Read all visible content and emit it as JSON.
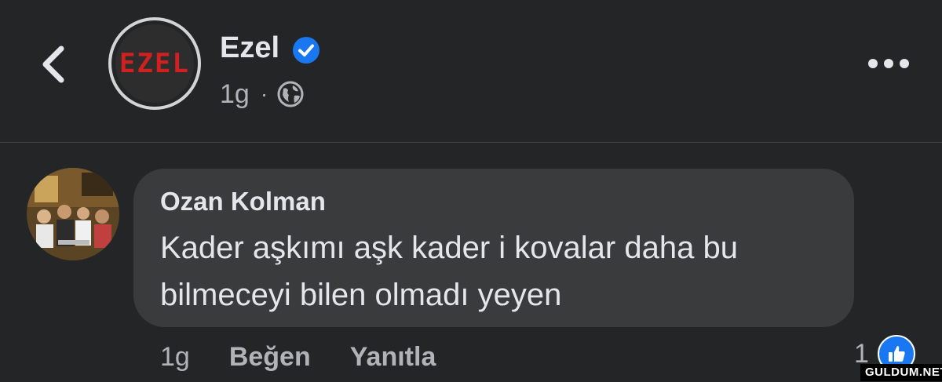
{
  "post": {
    "page_name": "Ezel",
    "avatar_text": "EZEL",
    "time": "1g",
    "separator": "·",
    "privacy_icon": "globe-icon",
    "verified_icon": "verified-badge-icon",
    "back_icon": "chevron-left-icon",
    "more_icon": "more-options-icon"
  },
  "comment": {
    "author": "Ozan Kolman",
    "text": "Kader aşkımı aşk kader i kovalar daha bu bilmeceyi bilen olmadı yeyen",
    "time": "1g",
    "like_label": "Beğen",
    "reply_label": "Yanıtla",
    "reaction_count": "1",
    "reaction_icon": "like-thumb-icon"
  },
  "watermark": "GULDUM.NET",
  "colors": {
    "background": "#242526",
    "bubble": "#3a3b3c",
    "accent": "#1a77f2",
    "secondary_text": "#b0b3b8"
  }
}
